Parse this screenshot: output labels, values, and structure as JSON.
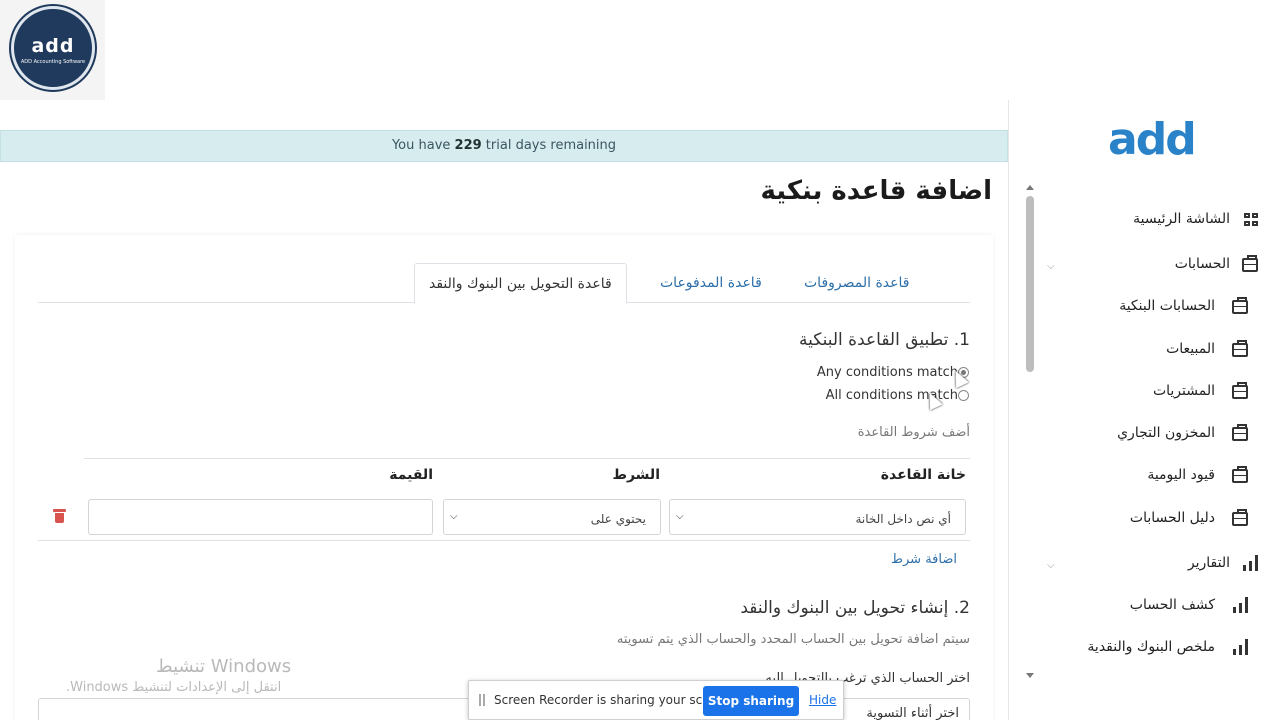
{
  "logo": {
    "text": "add",
    "subtitle": "ADD Accounting Software"
  },
  "banner": {
    "prefix": "You have ",
    "days": "229",
    "suffix": " trial days remaining"
  },
  "page_title": "اضافة قاعدة بنكية",
  "tabs": [
    {
      "label": "قاعدة المصروفات",
      "active": false
    },
    {
      "label": "قاعدة المدفوعات",
      "active": false
    },
    {
      "label": "قاعدة التحويل بين البنوك والنقد",
      "active": true
    }
  ],
  "section1": {
    "title": "1. تطبيق القاعدة البنكية",
    "options": [
      {
        "label": "Any conditions match",
        "selected": true
      },
      {
        "label": "All conditions match",
        "selected": false
      }
    ],
    "add_conditions_label": "أضف شروط القاعدة",
    "table": {
      "headers": {
        "field": "خانة القاعدة",
        "condition": "الشرط",
        "value": "القيمة"
      },
      "row": {
        "field": "أي نص داخل الخانة",
        "condition": "يحتوي على",
        "value": ""
      }
    },
    "add_condition_link": "اضافة شرط"
  },
  "section2": {
    "title": "2. إنشاء تحويل بين البنوك والنقد",
    "description": "سيتم اضافة تحويل بين الحساب المحدد والحساب الذي يتم تسويته",
    "select_label": "اختر الحساب الذي ترغب بالتحويل اليه",
    "partial_label": "اختر أثناء التسوية"
  },
  "watermark": {
    "line1": "تنشيط Windows",
    "line2": "انتقل إلى الإعدادات لتنشيط Windows."
  },
  "screen_share": {
    "message": "Screen Recorder is sharing your screen.",
    "stop": "Stop sharing",
    "hide": "Hide"
  },
  "sidebar": {
    "logo": "add",
    "items": [
      {
        "label": "الشاشة الرئيسية",
        "icon": "dashboard-grid-icon"
      },
      {
        "label": "الحسابات",
        "icon": "briefcase-icon",
        "expandable": true
      },
      {
        "label": "الحسابات البنكية",
        "icon": "briefcase-icon"
      },
      {
        "label": "المبيعات",
        "icon": "briefcase-icon"
      },
      {
        "label": "المشتريات",
        "icon": "briefcase-icon"
      },
      {
        "label": "المخزون التجاري",
        "icon": "briefcase-icon"
      },
      {
        "label": "قيود اليومية",
        "icon": "briefcase-icon"
      },
      {
        "label": "دليل الحسابات",
        "icon": "briefcase-icon"
      },
      {
        "label": "التقارير",
        "icon": "bar-chart-icon",
        "expandable": true
      },
      {
        "label": "كشف الحساب",
        "icon": "bar-chart-icon"
      },
      {
        "label": "ملخص البنوك والنقدية",
        "icon": "bar-chart-icon"
      }
    ]
  }
}
